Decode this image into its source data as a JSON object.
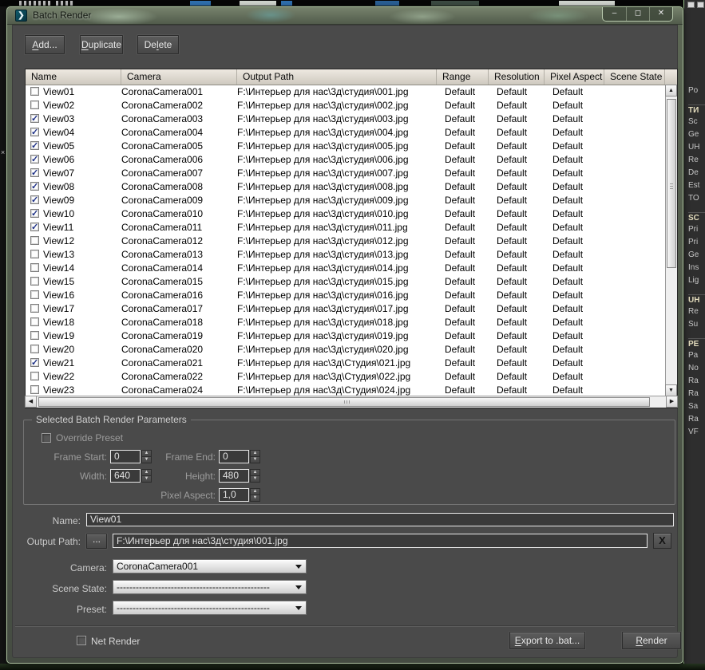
{
  "window": {
    "title": "Batch Render",
    "controls": {
      "minimize": "–",
      "maximize": "◻",
      "close": "✕"
    },
    "app_icon_glyph": "❯"
  },
  "toolbar": {
    "buttons": [
      {
        "id": "add-button",
        "label": "Add...",
        "mnemonic": "A"
      },
      {
        "id": "duplicate-button",
        "label": "Duplicate",
        "mnemonic": "D"
      },
      {
        "id": "delete-button",
        "label": "Delete",
        "mnemonic": "l"
      }
    ]
  },
  "table": {
    "columns": [
      "Name",
      "Camera",
      "Output Path",
      "Range",
      "Resolution",
      "Pixel Aspect",
      "Scene State"
    ],
    "rows": [
      {
        "checked": false,
        "name": "View01",
        "camera": "CoronaCamera001",
        "path": "F:\\Интерьер для нас\\3д\\студия\\001.jpg",
        "range": "Default",
        "resolution": "Default",
        "pixel_aspect": "Default",
        "scene_state": ""
      },
      {
        "checked": false,
        "name": "View02",
        "camera": "CoronaCamera002",
        "path": "F:\\Интерьер для нас\\3д\\студия\\002.jpg",
        "range": "Default",
        "resolution": "Default",
        "pixel_aspect": "Default",
        "scene_state": ""
      },
      {
        "checked": true,
        "name": "View03",
        "camera": "CoronaCamera003",
        "path": "F:\\Интерьер для нас\\3д\\студия\\003.jpg",
        "range": "Default",
        "resolution": "Default",
        "pixel_aspect": "Default",
        "scene_state": ""
      },
      {
        "checked": true,
        "name": "View04",
        "camera": "CoronaCamera004",
        "path": "F:\\Интерьер для нас\\3д\\студия\\004.jpg",
        "range": "Default",
        "resolution": "Default",
        "pixel_aspect": "Default",
        "scene_state": ""
      },
      {
        "checked": true,
        "name": "View05",
        "camera": "CoronaCamera005",
        "path": "F:\\Интерьер для нас\\3д\\студия\\005.jpg",
        "range": "Default",
        "resolution": "Default",
        "pixel_aspect": "Default",
        "scene_state": ""
      },
      {
        "checked": true,
        "name": "View06",
        "camera": "CoronaCamera006",
        "path": "F:\\Интерьер для нас\\3д\\студия\\006.jpg",
        "range": "Default",
        "resolution": "Default",
        "pixel_aspect": "Default",
        "scene_state": ""
      },
      {
        "checked": true,
        "name": "View07",
        "camera": "CoronaCamera007",
        "path": "F:\\Интерьер для нас\\3д\\студия\\007.jpg",
        "range": "Default",
        "resolution": "Default",
        "pixel_aspect": "Default",
        "scene_state": ""
      },
      {
        "checked": true,
        "name": "View08",
        "camera": "CoronaCamera008",
        "path": "F:\\Интерьер для нас\\3д\\студия\\008.jpg",
        "range": "Default",
        "resolution": "Default",
        "pixel_aspect": "Default",
        "scene_state": ""
      },
      {
        "checked": true,
        "name": "View09",
        "camera": "CoronaCamera009",
        "path": "F:\\Интерьер для нас\\3д\\студия\\009.jpg",
        "range": "Default",
        "resolution": "Default",
        "pixel_aspect": "Default",
        "scene_state": ""
      },
      {
        "checked": true,
        "name": "View10",
        "camera": "CoronaCamera010",
        "path": "F:\\Интерьер для нас\\3д\\студия\\010.jpg",
        "range": "Default",
        "resolution": "Default",
        "pixel_aspect": "Default",
        "scene_state": ""
      },
      {
        "checked": true,
        "name": "View11",
        "camera": "CoronaCamera011",
        "path": "F:\\Интерьер для нас\\3д\\студия\\011.jpg",
        "range": "Default",
        "resolution": "Default",
        "pixel_aspect": "Default",
        "scene_state": ""
      },
      {
        "checked": false,
        "name": "View12",
        "camera": "CoronaCamera012",
        "path": "F:\\Интерьер для нас\\3д\\студия\\012.jpg",
        "range": "Default",
        "resolution": "Default",
        "pixel_aspect": "Default",
        "scene_state": ""
      },
      {
        "checked": false,
        "name": "View13",
        "camera": "CoronaCamera013",
        "path": "F:\\Интерьер для нас\\3д\\студия\\013.jpg",
        "range": "Default",
        "resolution": "Default",
        "pixel_aspect": "Default",
        "scene_state": ""
      },
      {
        "checked": false,
        "name": "View14",
        "camera": "CoronaCamera014",
        "path": "F:\\Интерьер для нас\\3д\\студия\\014.jpg",
        "range": "Default",
        "resolution": "Default",
        "pixel_aspect": "Default",
        "scene_state": ""
      },
      {
        "checked": false,
        "name": "View15",
        "camera": "CoronaCamera015",
        "path": "F:\\Интерьер для нас\\3д\\студия\\015.jpg",
        "range": "Default",
        "resolution": "Default",
        "pixel_aspect": "Default",
        "scene_state": ""
      },
      {
        "checked": false,
        "name": "View16",
        "camera": "CoronaCamera016",
        "path": "F:\\Интерьер для нас\\3д\\студия\\016.jpg",
        "range": "Default",
        "resolution": "Default",
        "pixel_aspect": "Default",
        "scene_state": ""
      },
      {
        "checked": false,
        "name": "View17",
        "camera": "CoronaCamera017",
        "path": "F:\\Интерьер для нас\\3д\\студия\\017.jpg",
        "range": "Default",
        "resolution": "Default",
        "pixel_aspect": "Default",
        "scene_state": ""
      },
      {
        "checked": false,
        "name": "View18",
        "camera": "CoronaCamera018",
        "path": "F:\\Интерьер для нас\\3д\\студия\\018.jpg",
        "range": "Default",
        "resolution": "Default",
        "pixel_aspect": "Default",
        "scene_state": ""
      },
      {
        "checked": false,
        "name": "View19",
        "camera": "CoronaCamera019",
        "path": "F:\\Интерьер для нас\\3д\\студия\\019.jpg",
        "range": "Default",
        "resolution": "Default",
        "pixel_aspect": "Default",
        "scene_state": ""
      },
      {
        "checked": false,
        "name": "View20",
        "camera": "CoronaCamera020",
        "path": "F:\\Интерьер для нас\\3д\\студия\\020.jpg",
        "range": "Default",
        "resolution": "Default",
        "pixel_aspect": "Default",
        "scene_state": ""
      },
      {
        "checked": true,
        "name": "View21",
        "camera": "CoronaCamera021",
        "path": "F:\\Интерьер для нас\\3д\\Студия\\021.jpg",
        "range": "Default",
        "resolution": "Default",
        "pixel_aspect": "Default",
        "scene_state": ""
      },
      {
        "checked": false,
        "name": "View22",
        "camera": "CoronaCamera022",
        "path": "F:\\Интерьер для нас\\3д\\Студия\\022.jpg",
        "range": "Default",
        "resolution": "Default",
        "pixel_aspect": "Default",
        "scene_state": ""
      },
      {
        "checked": false,
        "name": "View23",
        "camera": "CoronaCamera024",
        "path": "F:\\Интерьер для нас\\3д\\Студия\\024.jpg",
        "range": "Default",
        "resolution": "Default",
        "pixel_aspect": "Default",
        "scene_state": ""
      }
    ]
  },
  "params": {
    "group_title": "Selected Batch Render Parameters",
    "override_preset_label": "Override Preset",
    "override_preset_checked": false,
    "frame_start_label": "Frame Start:",
    "frame_start": "0",
    "frame_end_label": "Frame End:",
    "frame_end": "0",
    "width_label": "Width:",
    "width": "640",
    "height_label": "Height:",
    "height": "480",
    "pixel_aspect_label": "Pixel Aspect:",
    "pixel_aspect": "1,0",
    "name_label": "Name:",
    "name": "View01",
    "output_path_label": "Output Path:",
    "browse_label": "...",
    "output_path": "F:\\Интерьер для нас\\3д\\студия\\001.jpg",
    "clear_label": "X",
    "camera_label": "Camera:",
    "camera": "CoronaCamera001",
    "scene_state_label": "Scene State:",
    "scene_state": "------------------------------------------------",
    "preset_label": "Preset:",
    "preset": "------------------------------------------------"
  },
  "footer": {
    "net_render_label": "Net Render",
    "net_render_checked": false,
    "export_label": "Export to .bat...",
    "export_mnemonic": "E",
    "render_label": "Render",
    "render_mnemonic": "R"
  },
  "background": {
    "side_labels": [
      {
        "t": "Po"
      },
      {
        "t": "ТИ",
        "h": true
      },
      {
        "t": "Sc"
      },
      {
        "t": "Ge"
      },
      {
        "t": "UH"
      },
      {
        "t": "Re"
      },
      {
        "t": "De"
      },
      {
        "t": "Est"
      },
      {
        "t": "TO"
      },
      {
        "t": "SC",
        "h": true
      },
      {
        "t": "Pri"
      },
      {
        "t": "Pri"
      },
      {
        "t": "Ge"
      },
      {
        "t": "Ins"
      },
      {
        "t": "Lig"
      },
      {
        "t": "UH",
        "h": true
      },
      {
        "t": "Re"
      },
      {
        "t": "Su"
      },
      {
        "t": "PE",
        "h": true
      },
      {
        "t": "Pa"
      },
      {
        "t": "No"
      },
      {
        "t": "Ra"
      },
      {
        "t": "Ra"
      },
      {
        "t": "Sa"
      },
      {
        "t": "Ra"
      },
      {
        "t": "VF"
      }
    ]
  }
}
